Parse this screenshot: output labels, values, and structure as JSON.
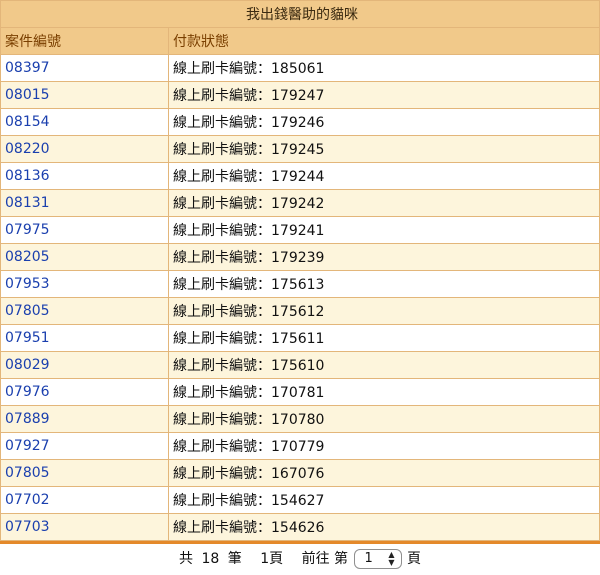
{
  "table": {
    "title": "我出錢醫助的貓咪",
    "col_id_header": "案件編號",
    "col_status_header": "付款狀態",
    "rows": [
      {
        "id": "08397",
        "status": "線上刷卡編號：185061"
      },
      {
        "id": "08015",
        "status": "線上刷卡編號：179247"
      },
      {
        "id": "08154",
        "status": "線上刷卡編號：179246"
      },
      {
        "id": "08220",
        "status": "線上刷卡編號：179245"
      },
      {
        "id": "08136",
        "status": "線上刷卡編號：179244"
      },
      {
        "id": "08131",
        "status": "線上刷卡編號：179242"
      },
      {
        "id": "07975",
        "status": "線上刷卡編號：179241"
      },
      {
        "id": "08205",
        "status": "線上刷卡編號：179239"
      },
      {
        "id": "07953",
        "status": "線上刷卡編號：175613"
      },
      {
        "id": "07805",
        "status": "線上刷卡編號：175612"
      },
      {
        "id": "07951",
        "status": "線上刷卡編號：175611"
      },
      {
        "id": "08029",
        "status": "線上刷卡編號：175610"
      },
      {
        "id": "07976",
        "status": "線上刷卡編號：170781"
      },
      {
        "id": "07889",
        "status": "線上刷卡編號：170780"
      },
      {
        "id": "07927",
        "status": "線上刷卡編號：170779"
      },
      {
        "id": "07805",
        "status": "線上刷卡編號：167076"
      },
      {
        "id": "07702",
        "status": "線上刷卡編號：154627"
      },
      {
        "id": "07703",
        "status": "線上刷卡編號：154626"
      }
    ]
  },
  "pager": {
    "total_prefix": "共",
    "total_count": "18",
    "total_suffix": "筆",
    "pages": "1頁",
    "goto_prefix": "前往 第",
    "selected_page": "1",
    "goto_suffix": "頁"
  },
  "colors": {
    "header_bg": "#f1c98a",
    "row_alt_bg": "#fdf5dc",
    "link": "#1a3fae",
    "bottom_bar": "#e4892a"
  },
  "icons": {
    "page_select": "updown-arrows-icon"
  }
}
